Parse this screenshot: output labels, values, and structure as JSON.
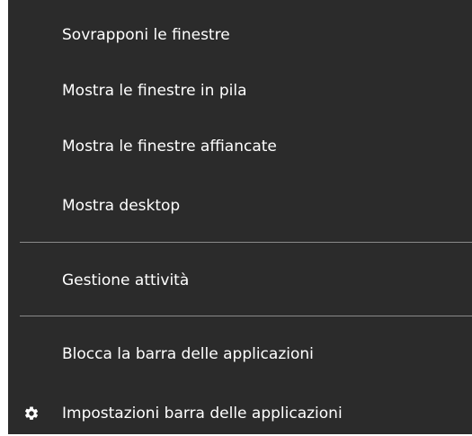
{
  "context_menu": {
    "items": [
      {
        "label": "Sovrapponi le finestre"
      },
      {
        "label": "Mostra le finestre in pila"
      },
      {
        "label": "Mostra le finestre affiancate"
      },
      {
        "label": "Mostra desktop"
      },
      {
        "label": "Gestione attività"
      },
      {
        "label": "Blocca la barra delle applicazioni"
      },
      {
        "label": "Impostazioni barra delle applicazioni",
        "icon": "gear-icon"
      }
    ],
    "colors": {
      "background": "#2b2b2b",
      "text": "#ffffff",
      "separator": "#8a8a8a"
    }
  }
}
